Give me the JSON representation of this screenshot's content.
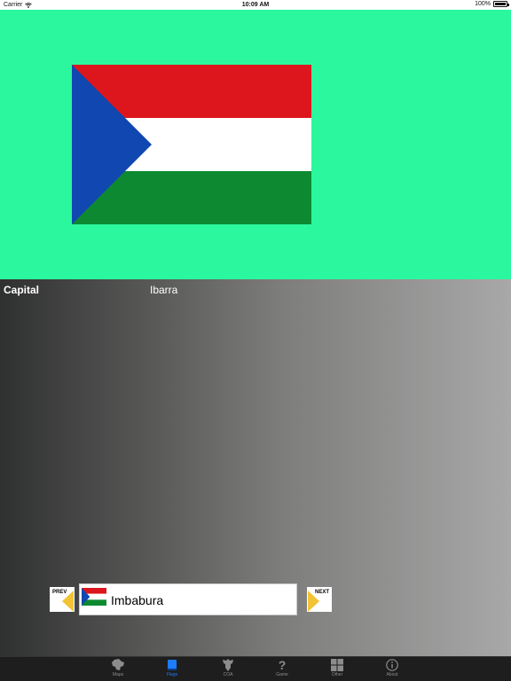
{
  "status_bar": {
    "carrier": "Carrier",
    "time": "10:09 AM",
    "battery": "100%"
  },
  "flag": {
    "name": "Imbabura",
    "background_color": "#2bf79f",
    "colors": {
      "red": "#dc161c",
      "white": "#ffffff",
      "green": "#0d8a31",
      "blue": "#1147b0"
    }
  },
  "info": {
    "capital_label": "Capital",
    "capital_value": "Ibarra"
  },
  "navigation": {
    "prev_label": "PREV",
    "next_label": "NEXT",
    "current_item": "Imbabura",
    "arrow_color": "#f2c335"
  },
  "tab_bar": {
    "active_color": "#1b7cff",
    "inactive_color": "#8c8c8c",
    "tabs": [
      {
        "label": "Maps",
        "icon": "map-icon"
      },
      {
        "label": "Flags",
        "icon": "book-icon",
        "active": true
      },
      {
        "label": "COA",
        "icon": "coat-of-arms-icon"
      },
      {
        "label": "Game",
        "icon": "question-icon"
      },
      {
        "label": "Other",
        "icon": "grid-icon"
      },
      {
        "label": "About",
        "icon": "info-icon"
      }
    ]
  }
}
